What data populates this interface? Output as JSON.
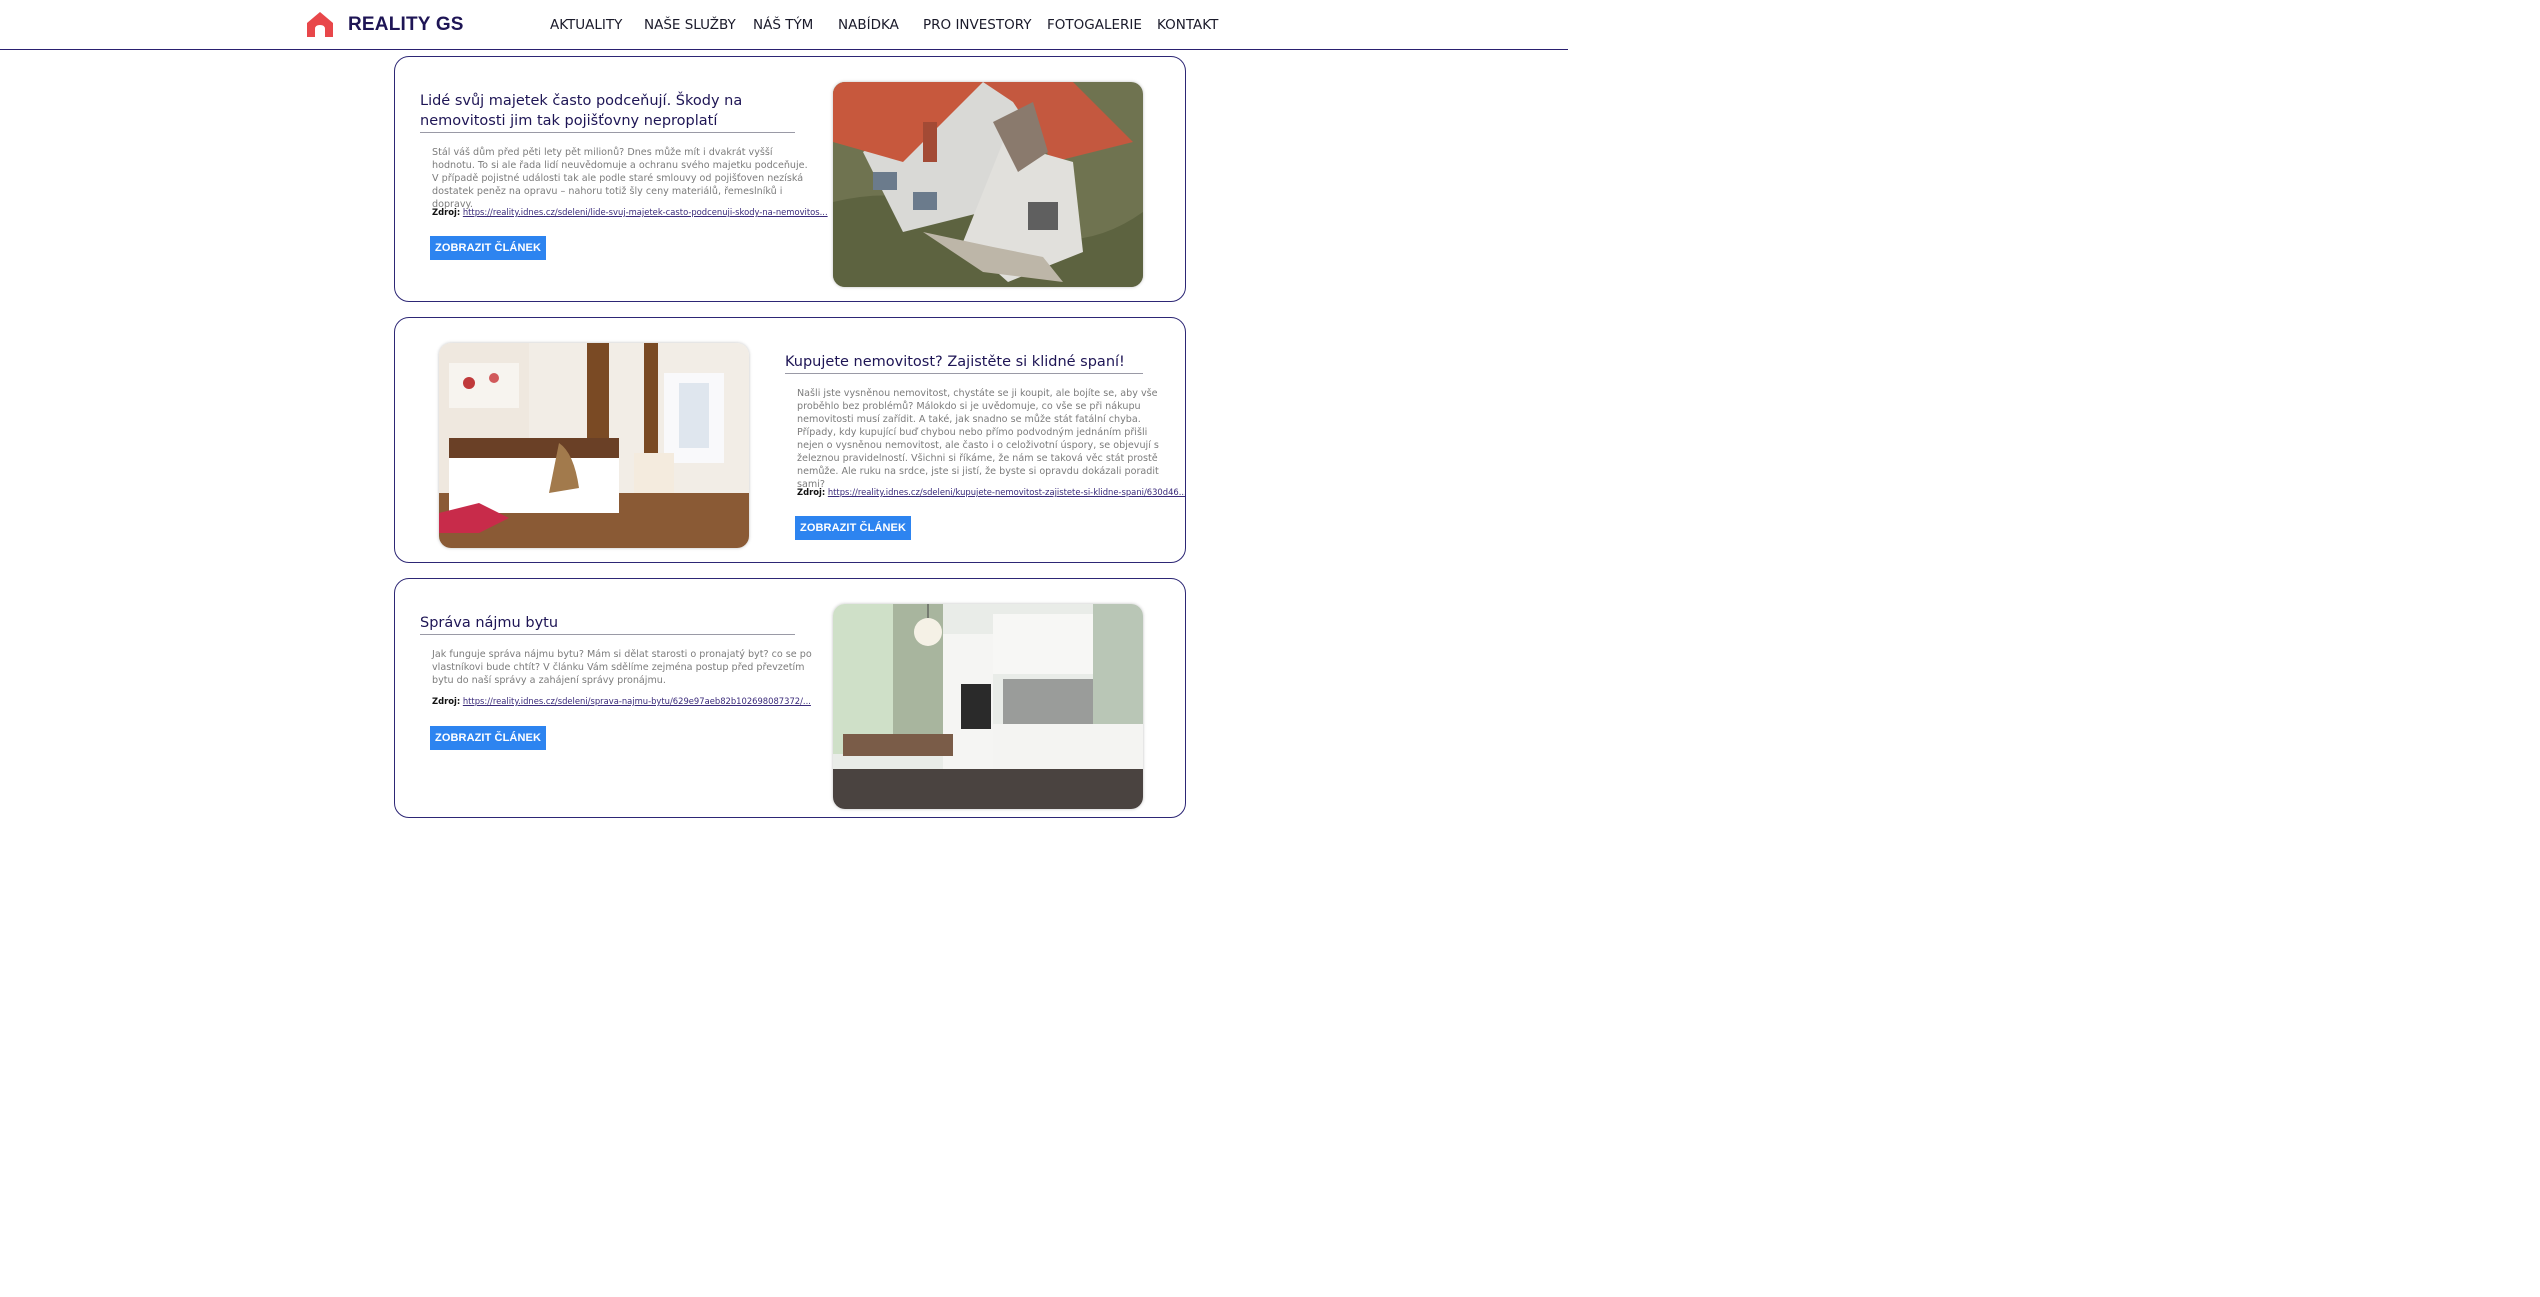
{
  "header": {
    "brand": "REALITY GS",
    "nav": [
      {
        "label": "AKTUALITY"
      },
      {
        "label": "NAŠE SLUŽBY"
      },
      {
        "label": "NÁŠ TÝM"
      },
      {
        "label": "NABÍDKA"
      },
      {
        "label": "PRO INVESTORY"
      },
      {
        "label": "FOTOGALERIE"
      },
      {
        "label": "KONTAKT"
      }
    ]
  },
  "articles": [
    {
      "title": "Lidé svůj majetek často podceňují. Škody na nemovitosti jim tak pojišťovny neproplatí",
      "text": "Stál váš dům před pěti lety pět milionů? Dnes může mít i dvakrát vyšší hodnotu. To si ale řada lidí neuvědomuje a ochranu svého majetku podceňuje. V případě pojistné události tak ale podle staré smlouvy od pojišťoven nezíská dostatek peněz na opravu – nahoru totiž šly ceny materiálů, řemeslníků i dopravy.",
      "source_label": "Zdroj:",
      "source_url": "https://reality.idnes.cz/sdeleni/lide-svuj-majetek-casto-podcenuji-skody-na-nemovitos...",
      "button": "ZOBRAZIT ČLÁNEK",
      "image": "damaged-house-image"
    },
    {
      "title": "Kupujete nemovitost? Zajistěte si klidné spaní!",
      "text": "Našli jste vysněnou nemovitost, chystáte se ji koupit, ale bojíte se, aby vše proběhlo bez problémů? Málokdo si je uvědomuje, co vše se při nákupu nemovitosti musí zařídit. A také, jak snadno se může stát fatální chyba. Případy, kdy kupující buď chybou nebo přímo podvodným jednáním přišli nejen o vysněnou nemovitost, ale často i o celoživotní úspory, se objevují s železnou pravidelností. Všichni si říkáme, že nám se taková věc stát prostě nemůže. Ale ruku na srdce, jste si jistí, že byste si opravdu dokázali poradit sami?",
      "source_label": "Zdroj:",
      "source_url": "https://reality.idnes.cz/sdeleni/kupujete-nemovitost-zajistete-si-klidne-spani/630d46...",
      "button": "ZOBRAZIT ČLÁNEK",
      "image": "bedroom-image"
    },
    {
      "title": "Správa nájmu bytu",
      "text": "Jak funguje správa nájmu bytu? Mám si dělat starosti o pronajatý byt? co se po vlastníkovi bude chtít? V článku Vám sdělíme zejména postup před převzetím bytu do naší správy a zahájení správy pronájmu.",
      "source_label": "Zdroj:",
      "source_url": "https://reality.idnes.cz/sdeleni/sprava-najmu-bytu/629e97aeb82b102698087372/...",
      "button": "ZOBRAZIT ČLÁNEK",
      "image": "kitchen-image"
    }
  ],
  "colors": {
    "brand": "#1e1555",
    "accent_button": "#2d84f0",
    "logo_red": "#e8474a",
    "card_border": "#2d2775"
  }
}
